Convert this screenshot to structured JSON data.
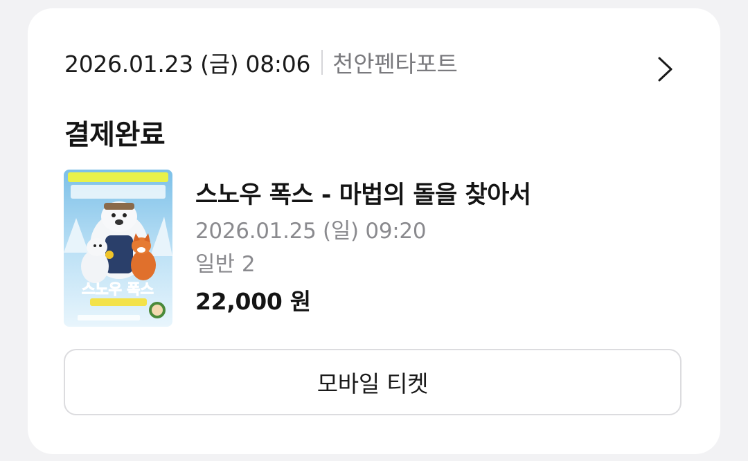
{
  "booking": {
    "datetime": "2026.01.23 (금) 08:06",
    "theater": "천안펜타포트",
    "status": "결제완료"
  },
  "movie": {
    "title": "스노우 폭스 - 마법의 돌을 찾아서",
    "showtime": "2026.01.25 (일) 09:20",
    "ticket_type": "일반 2",
    "price": "22,000 원",
    "poster": {
      "title_text": "스노우 폭스",
      "icon": "movie-poster-image"
    }
  },
  "actions": {
    "mobile_ticket_label": "모바일 티켓",
    "detail_icon": "chevron-right-icon"
  }
}
